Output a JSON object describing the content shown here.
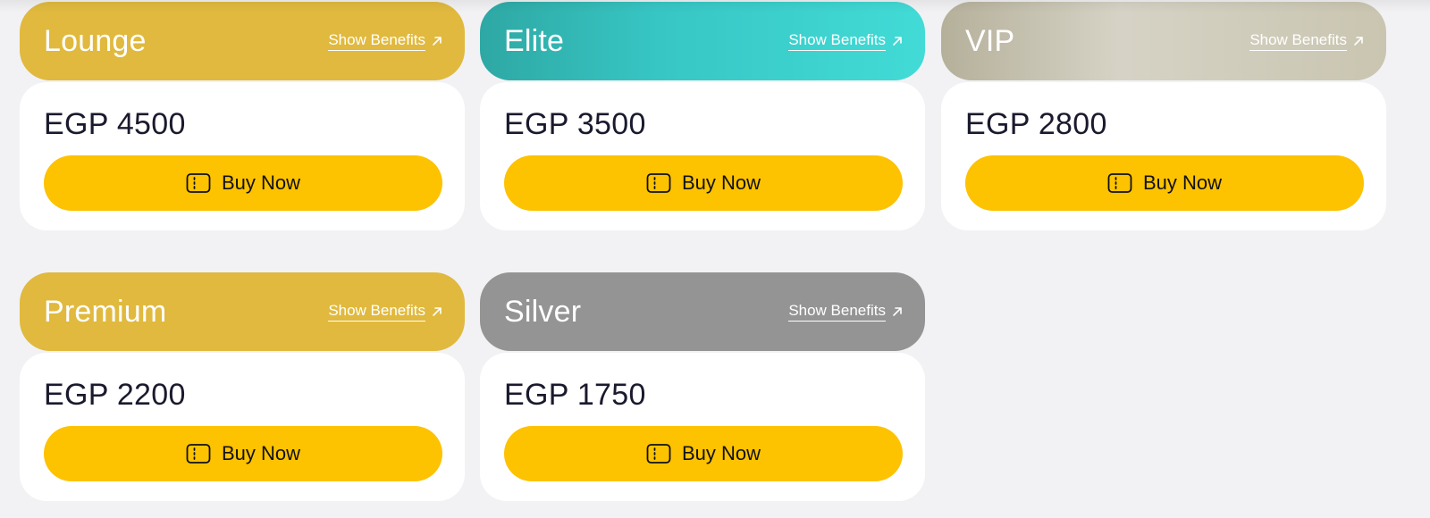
{
  "tiers": [
    {
      "name": "Lounge",
      "benefits_label": "Show Benefits",
      "price": "EGP 4500",
      "buy_label": "Buy Now",
      "header_color": "#e0b93e"
    },
    {
      "name": "Elite",
      "benefits_label": "Show Benefits",
      "price": "EGP 3500",
      "buy_label": "Buy Now",
      "header_color": "#37c6c4"
    },
    {
      "name": "VIP",
      "benefits_label": "Show Benefits",
      "price": "EGP 2800",
      "buy_label": "Buy Now",
      "header_color": "#cfcbba"
    },
    {
      "name": "Premium",
      "benefits_label": "Show Benefits",
      "price": "EGP 2200",
      "buy_label": "Buy Now",
      "header_color": "#e0b93e"
    },
    {
      "name": "Silver",
      "benefits_label": "Show Benefits",
      "price": "EGP 1750",
      "buy_label": "Buy Now",
      "header_color": "#949494"
    }
  ],
  "colors": {
    "buy_button": "#fdc200",
    "page_background": "#f2f2f5",
    "card_background": "#ffffff"
  },
  "icons": {
    "benefits": "arrow-up-right-icon",
    "buy": "ticket-icon"
  }
}
